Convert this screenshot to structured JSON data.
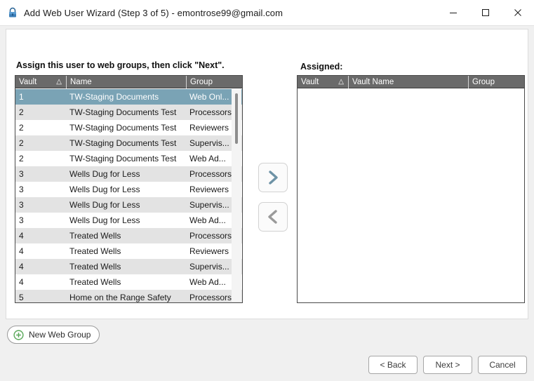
{
  "window": {
    "title": "Add Web User Wizard (Step 3 of 5) - emontrose99@gmail.com",
    "lock_icon": "lock-icon",
    "controls": {
      "minimize": "minimize-icon",
      "maximize": "maximize-icon",
      "close": "close-icon"
    }
  },
  "main": {
    "instruction": "Assign this user to web groups, then click \"Next\".",
    "assigned_label": "Assigned:"
  },
  "available_list": {
    "columns": {
      "vault": "Vault",
      "name": "Name",
      "group": "Group",
      "sort_indicator": "△"
    },
    "rows": [
      {
        "vault": "1",
        "name": "TW-Staging Documents",
        "group": "Web Onl..."
      },
      {
        "vault": "2",
        "name": "TW-Staging Documents Test",
        "group": "Processors"
      },
      {
        "vault": "2",
        "name": "TW-Staging Documents Test",
        "group": "Reviewers"
      },
      {
        "vault": "2",
        "name": "TW-Staging Documents Test",
        "group": "Supervis..."
      },
      {
        "vault": "2",
        "name": "TW-Staging Documents Test",
        "group": "Web Ad..."
      },
      {
        "vault": "3",
        "name": "Wells Dug for Less",
        "group": "Processors"
      },
      {
        "vault": "3",
        "name": "Wells Dug for Less",
        "group": "Reviewers"
      },
      {
        "vault": "3",
        "name": "Wells Dug for Less",
        "group": "Supervis..."
      },
      {
        "vault": "3",
        "name": "Wells Dug for Less",
        "group": "Web Ad..."
      },
      {
        "vault": "4",
        "name": "Treated Wells",
        "group": "Processors"
      },
      {
        "vault": "4",
        "name": "Treated Wells",
        "group": "Reviewers"
      },
      {
        "vault": "4",
        "name": "Treated Wells",
        "group": "Supervis..."
      },
      {
        "vault": "4",
        "name": "Treated Wells",
        "group": "Web Ad..."
      },
      {
        "vault": "5",
        "name": "Home on the Range Safety",
        "group": "Processors"
      }
    ],
    "selected_index": 0
  },
  "assigned_list": {
    "columns": {
      "vault": "Vault",
      "name": "Vault Name",
      "group": "Group",
      "sort_indicator": "△"
    },
    "rows": []
  },
  "transfer": {
    "add_icon": "chevron-right-icon",
    "remove_icon": "chevron-left-icon",
    "add_color": "#6e93a6",
    "remove_color": "#9a9a9a"
  },
  "footer": {
    "new_group_label": "New Web Group",
    "new_group_icon": "plus-circle-icon",
    "back_label": "< Back",
    "next_label": "Next >",
    "cancel_label": "Cancel"
  },
  "colors": {
    "selection": "#7aa3b5",
    "header": "#6a6a6a",
    "row_alt": "#e3e3e3",
    "window_bg": "#f0f0f0"
  }
}
